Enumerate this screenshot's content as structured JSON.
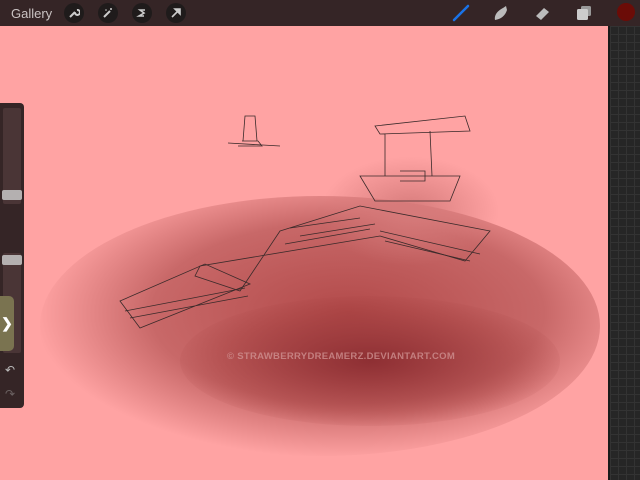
{
  "topbar": {
    "gallery_label": "Gallery",
    "left_tools": [
      "wrench-icon",
      "magic-wand-icon",
      "selection-icon",
      "transform-arrow-icon"
    ],
    "right_tools": [
      "brush-icon",
      "smudge-icon",
      "eraser-icon",
      "layers-icon"
    ]
  },
  "colors": {
    "current_color": "#6b0c07",
    "active_brush": "#1a73e8",
    "canvas": "#ffa3a3"
  },
  "sidebar": {
    "tab_glyph": "❯",
    "undo_glyph": "↶",
    "redo_glyph": "↷"
  },
  "watermark": "© STRAWBERRYDREAMERZ.DEVIANTART.COM"
}
